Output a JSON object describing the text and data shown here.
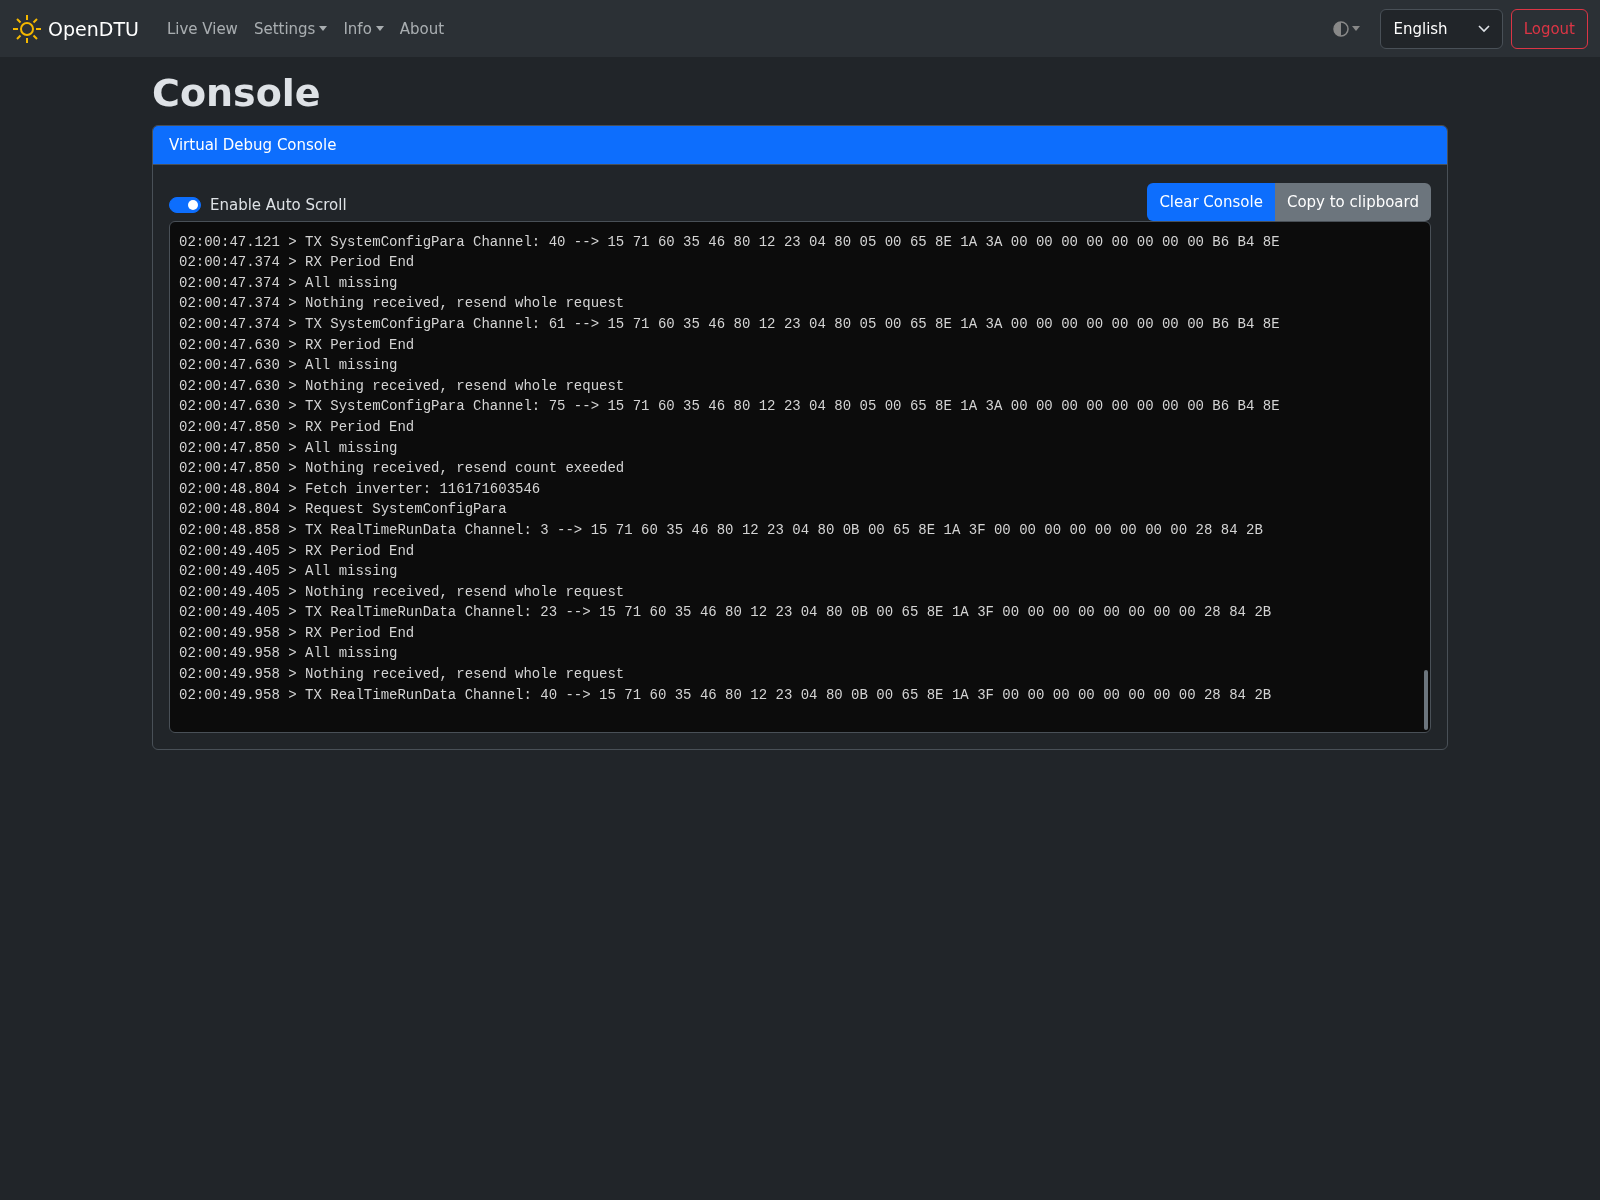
{
  "navbar": {
    "brand": "OpenDTU",
    "items": [
      {
        "label": "Live View",
        "dropdown": false
      },
      {
        "label": "Settings",
        "dropdown": true
      },
      {
        "label": "Info",
        "dropdown": true
      },
      {
        "label": "About",
        "dropdown": false
      }
    ],
    "language": "English",
    "logout": "Logout"
  },
  "page": {
    "title": "Console"
  },
  "card": {
    "header": "Virtual Debug Console",
    "auto_scroll": {
      "label": "Enable Auto Scroll",
      "on": true
    },
    "buttons": [
      {
        "label": "Clear Console",
        "kind": "primary"
      },
      {
        "label": "Copy to clipboard",
        "kind": "secondary"
      }
    ],
    "lines": [
      "02:00:47.121 > TX SystemConfigPara Channel: 40 --> 15 71 60 35 46 80 12 23 04 80 05 00 65 8E 1A 3A 00 00 00 00 00 00 00 00 B6 B4 8E",
      "02:00:47.374 > RX Period End",
      "02:00:47.374 > All missing",
      "02:00:47.374 > Nothing received, resend whole request",
      "02:00:47.374 > TX SystemConfigPara Channel: 61 --> 15 71 60 35 46 80 12 23 04 80 05 00 65 8E 1A 3A 00 00 00 00 00 00 00 00 B6 B4 8E",
      "02:00:47.630 > RX Period End",
      "02:00:47.630 > All missing",
      "02:00:47.630 > Nothing received, resend whole request",
      "02:00:47.630 > TX SystemConfigPara Channel: 75 --> 15 71 60 35 46 80 12 23 04 80 05 00 65 8E 1A 3A 00 00 00 00 00 00 00 00 B6 B4 8E",
      "02:00:47.850 > RX Period End",
      "02:00:47.850 > All missing",
      "02:00:47.850 > Nothing received, resend count exeeded",
      "02:00:48.804 > Fetch inverter: 116171603546",
      "02:00:48.804 > Request SystemConfigPara",
      "02:00:48.858 > TX RealTimeRunData Channel: 3 --> 15 71 60 35 46 80 12 23 04 80 0B 00 65 8E 1A 3F 00 00 00 00 00 00 00 00 28 84 2B",
      "02:00:49.405 > RX Period End",
      "02:00:49.405 > All missing",
      "02:00:49.405 > Nothing received, resend whole request",
      "02:00:49.405 > TX RealTimeRunData Channel: 23 --> 15 71 60 35 46 80 12 23 04 80 0B 00 65 8E 1A 3F 00 00 00 00 00 00 00 00 28 84 2B",
      "02:00:49.958 > RX Period End",
      "02:00:49.958 > All missing",
      "02:00:49.958 > Nothing received, resend whole request",
      "02:00:49.958 > TX RealTimeRunData Channel: 40 --> 15 71 60 35 46 80 12 23 04 80 0B 00 65 8E 1A 3F 00 00 00 00 00 00 00 00 28 84 2B"
    ]
  }
}
